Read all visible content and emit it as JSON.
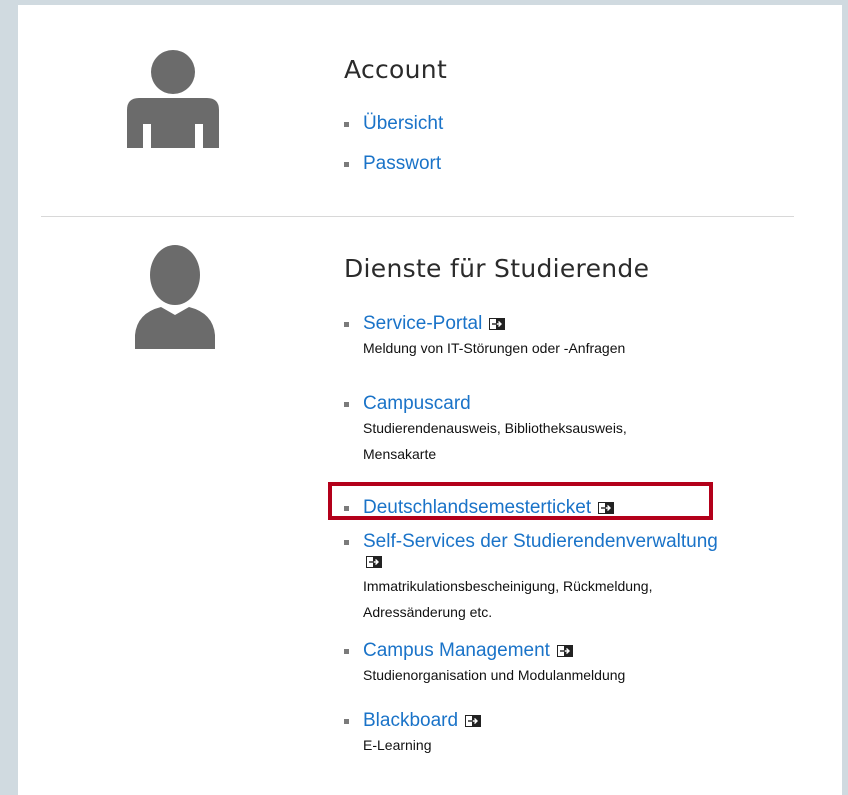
{
  "account": {
    "title": "Account",
    "links": [
      {
        "label": "Übersicht"
      },
      {
        "label": "Passwort"
      }
    ]
  },
  "students": {
    "title": "Dienste für Studierende",
    "items": [
      {
        "label": "Service-Portal",
        "external": true,
        "desc": [
          "Meldung von IT-Störungen oder -Anfragen"
        ]
      },
      {
        "label": "Campuscard",
        "external": false,
        "desc": [
          "Studierendenausweis, Bibliotheksausweis,",
          "Mensakarte"
        ]
      },
      {
        "label": "Deutschlandsemesterticket",
        "external": true,
        "desc": []
      },
      {
        "label": "Self-Services der Studierendenverwaltung",
        "external": true,
        "desc": [
          "Immatrikulationsbescheinigung, Rückmeldung,",
          "Adressänderung etc."
        ]
      },
      {
        "label": "Campus Management",
        "external": true,
        "desc": [
          "Studienorganisation und Modulanmeldung"
        ]
      },
      {
        "label": "Blackboard",
        "external": true,
        "desc": [
          "E-Learning"
        ]
      }
    ]
  },
  "colors": {
    "link": "#1a73c8",
    "highlight": "#b3001a",
    "avatar": "#6b6b6b"
  },
  "icons": {
    "avatar": "user-icon",
    "external": "external-link-icon"
  }
}
